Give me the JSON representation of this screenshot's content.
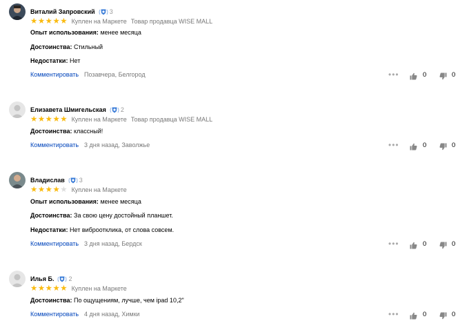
{
  "reviews": [
    {
      "author": "Виталий Запровский",
      "badge_count": "3",
      "rating": 5,
      "purchase": "Куплен на Маркете",
      "seller": "Товар продавца WISE MALL",
      "fields": [
        {
          "label": "Опыт использования:",
          "value": "менее месяца"
        },
        {
          "label": "Достоинства:",
          "value": "Стильный"
        },
        {
          "label": "Недостатки:",
          "value": "Нет"
        }
      ],
      "comment_label": "Комментировать",
      "date": "Позавчера, Белгород",
      "likes": "0",
      "dislikes": "0"
    },
    {
      "author": "Елизавета Шмигельская",
      "badge_count": "2",
      "rating": 5,
      "purchase": "Куплен на Маркете",
      "seller": "Товар продавца WISE MALL",
      "fields": [
        {
          "label": "Достоинства:",
          "value": "классный!"
        }
      ],
      "comment_label": "Комментировать",
      "date": "3 дня назад, Заволжье",
      "likes": "0",
      "dislikes": "0"
    },
    {
      "author": "Владислав",
      "badge_count": "3",
      "rating": 4,
      "purchase": "Куплен на Маркете",
      "seller": "",
      "fields": [
        {
          "label": "Опыт использования:",
          "value": "менее месяца"
        },
        {
          "label": "Достоинства:",
          "value": "За свою цену достойный планшет."
        },
        {
          "label": "Недостатки:",
          "value": "Нет виброотклика, от слова совсем."
        }
      ],
      "comment_label": "Комментировать",
      "date": "3 дня назад, Бердск",
      "likes": "0",
      "dislikes": "0"
    },
    {
      "author": "Илья Б.",
      "badge_count": "2",
      "rating": 5,
      "purchase": "Куплен на Маркете",
      "seller": "",
      "fields": [
        {
          "label": "Достоинства:",
          "value": "По ощущениям, лучше, чем ipad 10,2\""
        }
      ],
      "comment_label": "Комментировать",
      "date": "4 дня назад, Химки",
      "likes": "0",
      "dislikes": "0"
    }
  ],
  "colors": {
    "star": "#fabb11",
    "link": "#0044bb",
    "muted": "#777777",
    "badge_blue": "#3b7dd8"
  },
  "icons": [
    "expert-badge-icon",
    "star-icon",
    "more-dots-icon",
    "thumb-up-icon",
    "thumb-down-icon",
    "avatar-icon"
  ]
}
